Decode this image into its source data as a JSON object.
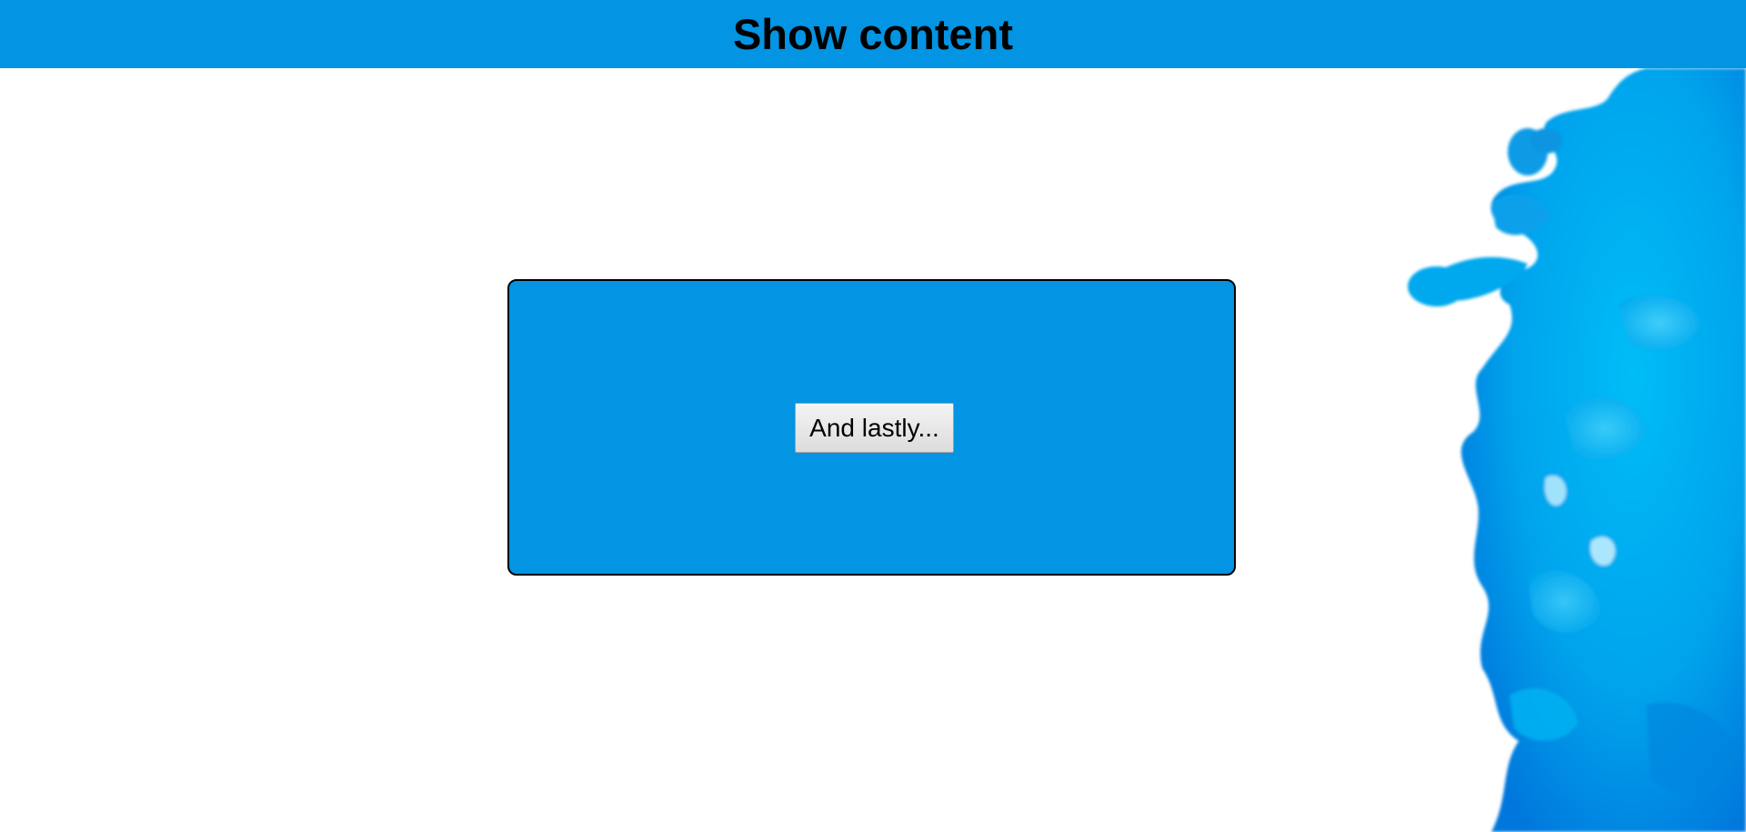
{
  "header": {
    "title": "Show content"
  },
  "panel": {
    "button_label": "And lastly..."
  },
  "colors": {
    "accent": "#0394e3",
    "ink": "#00a6ee"
  },
  "decoration": {
    "image": "blue-ink-cloud-image"
  }
}
